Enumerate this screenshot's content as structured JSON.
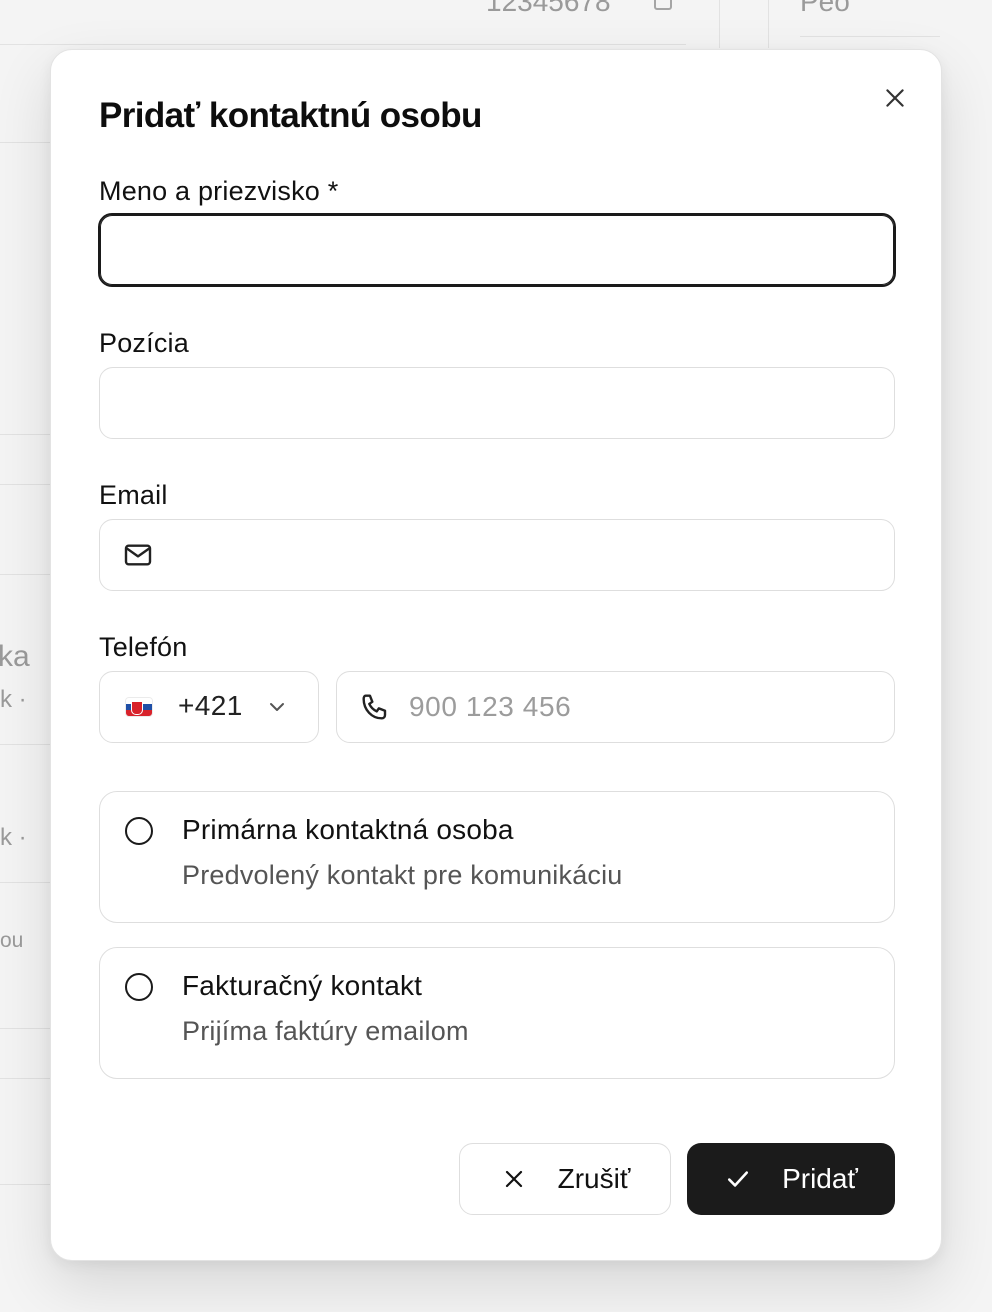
{
  "background": {
    "top_number": "12345678",
    "top_right_text": "Peo",
    "partial_texts": [
      "ka",
      "k  ·",
      "k  ·",
      "ou"
    ]
  },
  "modal": {
    "title": "Pridať kontaktnú osobu",
    "close_icon": "close-icon",
    "fields": {
      "name": {
        "label": "Meno a priezvisko *",
        "value": "",
        "placeholder": ""
      },
      "position": {
        "label": "Pozícia",
        "value": "",
        "placeholder": ""
      },
      "email": {
        "label": "Email",
        "value": "",
        "placeholder": "",
        "icon": "mail-icon"
      },
      "phone": {
        "label": "Telefón",
        "country_flag": "slovakia-flag",
        "dial_code": "+421",
        "value": "",
        "placeholder": "900 123 456",
        "icon": "phone-icon"
      }
    },
    "options": [
      {
        "title": "Primárna kontaktná osoba",
        "description": "Predvolený kontakt pre komunikáciu",
        "checked": false
      },
      {
        "title": "Fakturačný kontakt",
        "description": "Prijíma faktúry emailom",
        "checked": false
      }
    ],
    "buttons": {
      "cancel": {
        "label": "Zrušiť",
        "icon": "x-icon"
      },
      "submit": {
        "label": "Pridať",
        "icon": "check-icon"
      }
    }
  },
  "colors": {
    "primary_button": "#1b1b1b",
    "border": "#dedede",
    "focus_border": "#1a1a1a",
    "placeholder": "#9c9c9c"
  }
}
